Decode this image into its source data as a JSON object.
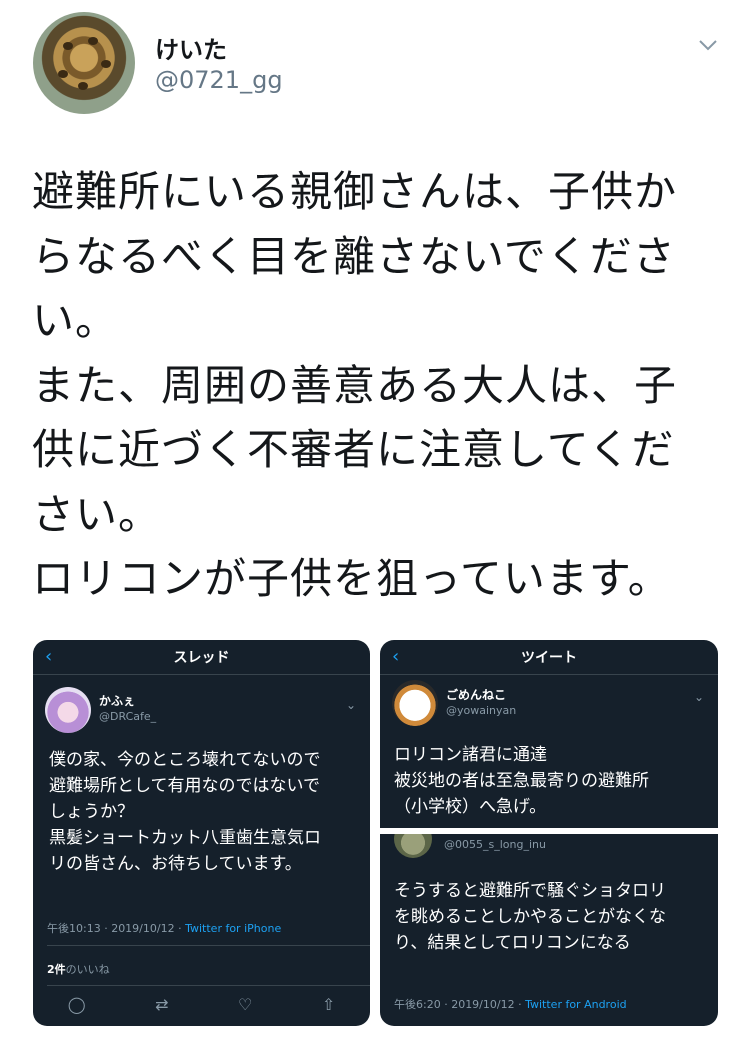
{
  "tweet": {
    "display_name": "けいた",
    "handle": "@0721_gg",
    "lines": [
      "避難所にいる親御さんは、子供か",
      "らなるべく目を離さないでくださ",
      "い。",
      "また、周囲の善意ある大人は、子",
      "供に近づく不審者に注意してくだ",
      "さい。",
      "ロリコンが子供を狙っています。"
    ]
  },
  "screenshot_left": {
    "header_title": "スレッド",
    "name": "かふぇ",
    "handle": "@DRCafe_",
    "lines": [
      "僕の家、今のところ壊れてないので",
      "避難場所として有用なのではないで",
      "しょうか？",
      "黒髪ショートカット八重歯生意気ロ",
      "リの皆さん、お待ちしています。"
    ],
    "meta_time": "午後10:13 · 2019/10/12 · ",
    "meta_source": "Twitter for iPhone",
    "likes_count": "2件",
    "likes_label": "のいいね"
  },
  "screenshot_right_top": {
    "header_title": "ツイート",
    "name": "ごめんねこ",
    "handle": "@yowainyan",
    "lines": [
      "ロリコン諸君に通達",
      "被災地の者は至急最寄りの避難所",
      "（小学校）へ急げ。"
    ]
  },
  "screenshot_right_bottom": {
    "handle": "@0055_s_long_inu",
    "lines": [
      "そうすると避難所で騒ぐショタロリ",
      "を眺めることしかやることがなくな",
      "り、結果としてロリコンになる"
    ],
    "meta_time": "午後6:20 · 2019/10/12 · ",
    "meta_source": "Twitter for Android"
  },
  "icons": {
    "chevron": "chevron-down-icon",
    "back": "back-arrow-icon",
    "reply": "reply-icon",
    "retweet": "retweet-icon",
    "like": "heart-icon",
    "share": "share-icon"
  },
  "colors": {
    "link_blue": "#1da1f2",
    "dark_bg": "#15202b",
    "muted": "#657786"
  }
}
